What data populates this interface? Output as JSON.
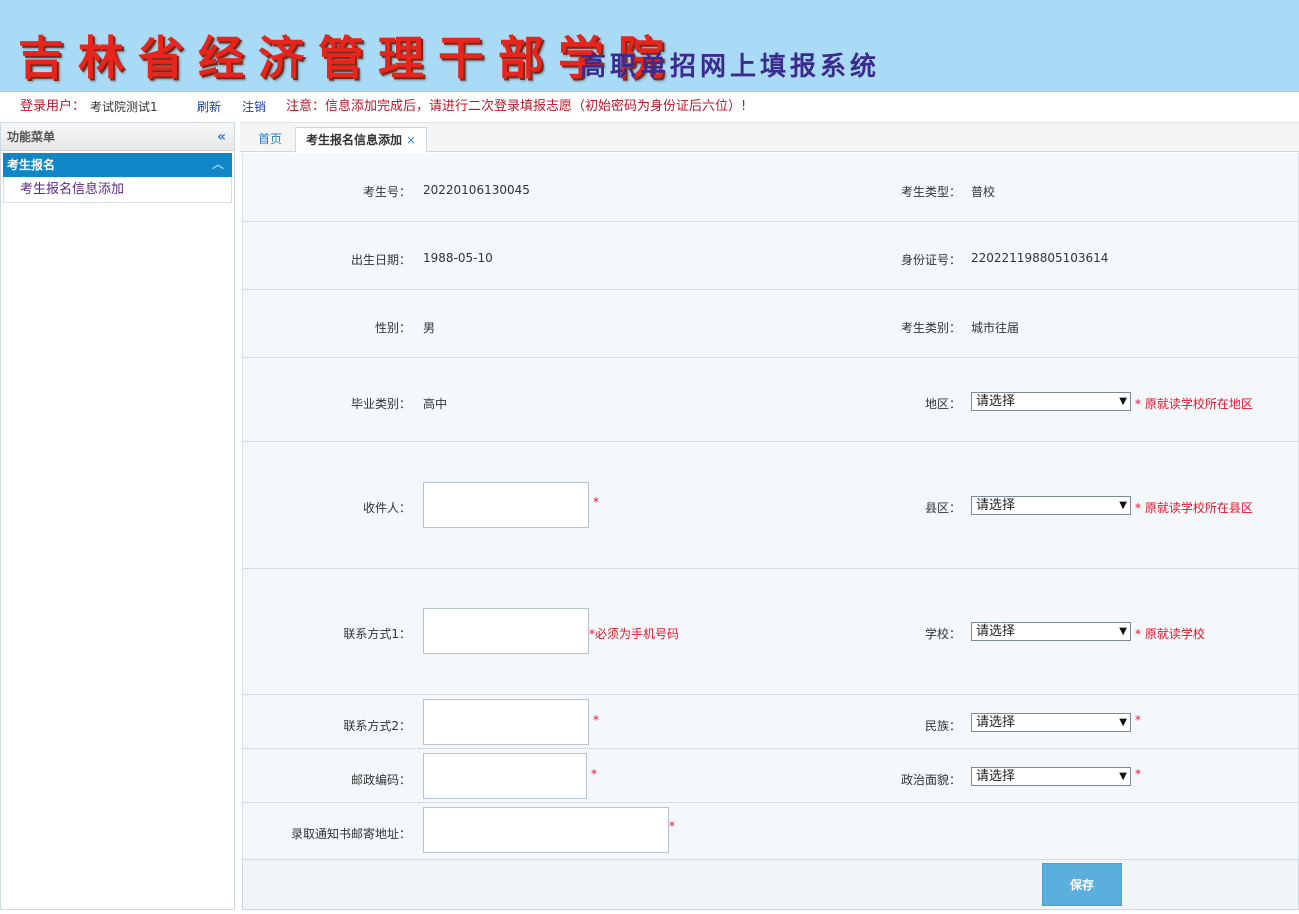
{
  "banner": {
    "school_name": "吉林省经济管理干部学院",
    "system_name": "高职单招网上填报系统"
  },
  "infobar": {
    "user_label": "登录用户：",
    "user_name": "考试院测试1",
    "refresh": "刷新",
    "logout": "注销",
    "notice": "注意：信息添加完成后，请进行二次登录填报志愿（初始密码为身份证后六位）!"
  },
  "sidebar": {
    "title": "功能菜单",
    "collapse_icon": "«",
    "group_label": "考生报名",
    "items": [
      {
        "label": "考生报名信息添加"
      }
    ]
  },
  "tabs": [
    {
      "label": "首页"
    },
    {
      "label": "考生报名信息添加",
      "close": "×"
    }
  ],
  "form": {
    "exam_no": {
      "label": "考生号：",
      "value": "20220106130045"
    },
    "exam_type": {
      "label": "考生类型：",
      "value": "普校"
    },
    "birth": {
      "label": "出生日期：",
      "value": "1988-05-10"
    },
    "id_no": {
      "label": "身份证号：",
      "value": "220221198805103614"
    },
    "gender": {
      "label": "性别：",
      "value": "男"
    },
    "category": {
      "label": "考生类别：",
      "value": "城市往届"
    },
    "grad_type": {
      "label": "毕业类别：",
      "value": "高中"
    },
    "region": {
      "label": "地区：",
      "selected": "请选择",
      "hint": "* 原就读学校所在地区"
    },
    "recipient": {
      "label": "收件人：",
      "value": "",
      "hint": "*"
    },
    "county": {
      "label": "县区：",
      "selected": "请选择",
      "hint": "* 原就读学校所在县区"
    },
    "contact1": {
      "label": "联系方式1：",
      "value": "",
      "hint": "*必须为手机号码"
    },
    "school": {
      "label": "学校：",
      "selected": "请选择",
      "hint": "* 原就读学校"
    },
    "contact2": {
      "label": "联系方式2：",
      "value": "",
      "hint": "*"
    },
    "ethnic": {
      "label": "民族：",
      "selected": "请选择",
      "hint": "*"
    },
    "postcode": {
      "label": "邮政编码：",
      "value": "",
      "hint": "*"
    },
    "political": {
      "label": "政治面貌：",
      "selected": "请选择",
      "hint": "*"
    },
    "address": {
      "label": "录取通知书邮寄地址：",
      "value": "",
      "hint": "*"
    }
  },
  "save_label": "保存",
  "colors": {
    "banner_bg": "#a9dbf6",
    "school_red": "#e8251c",
    "system_purple": "#3b2b8f",
    "menu_active": "#0e86c7",
    "required_red": "#e0162b",
    "save_button": "#5aafdd"
  }
}
